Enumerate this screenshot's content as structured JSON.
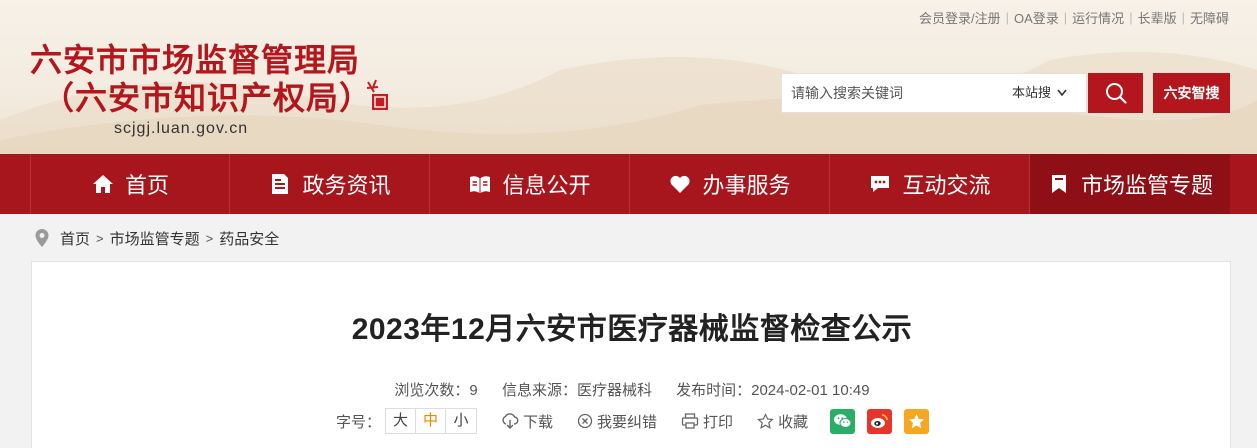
{
  "top_links": [
    "会员登录/注册",
    "OA登录",
    "运行情况",
    "长辈版",
    "无障碍"
  ],
  "logo": {
    "title_line1": "六安市市场监督管理局",
    "title_line2": "（六安市知识产权局）",
    "domain": "scjgj.luan.gov.cn"
  },
  "search": {
    "placeholder": "请输入搜索关键词",
    "scope": "本站搜",
    "smart_button": "六安智搜"
  },
  "nav": [
    {
      "label": "首页",
      "icon": "home-icon"
    },
    {
      "label": "政务资讯",
      "icon": "document-icon"
    },
    {
      "label": "信息公开",
      "icon": "open-book-icon"
    },
    {
      "label": "办事服务",
      "icon": "heart-icon"
    },
    {
      "label": "互动交流",
      "icon": "chat-icon"
    },
    {
      "label": "市场监管专题",
      "icon": "bookmark-icon"
    }
  ],
  "breadcrumb": [
    "首页",
    "市场监管专题",
    "药品安全"
  ],
  "article": {
    "title": "2023年12月六安市医疗器械监督检查公示",
    "views": "浏览次数：9",
    "source": "信息来源：医疗器械科",
    "published": "发布时间：2024-02-01 10:49"
  },
  "tools": {
    "font_label": "字号：",
    "font_sizes": [
      "大",
      "中",
      "小"
    ],
    "download": "下载",
    "report_error": "我要纠错",
    "print": "打印",
    "favorite": "收藏"
  },
  "colors": {
    "brand_red": "#b3161c",
    "nav_red": "#a8161d",
    "active_font": "#e58a00",
    "wechat": "#2aae67",
    "weibo": "#e6352b",
    "qzone": "#f5a623"
  }
}
